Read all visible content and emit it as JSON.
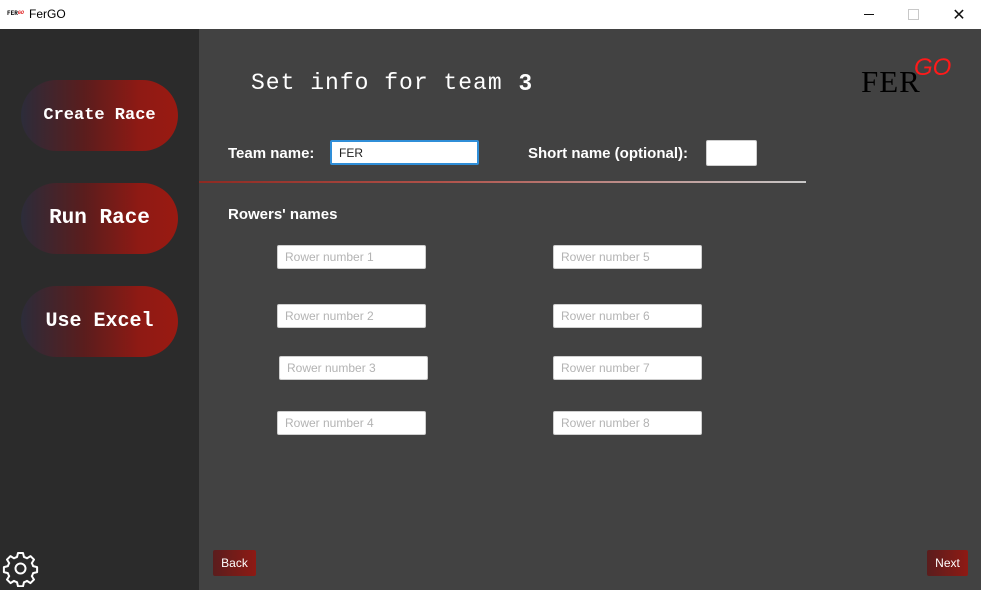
{
  "window": {
    "icon_text": "FER",
    "icon_text_go": "GO",
    "title": "FerGO",
    "minimize_label": "",
    "maximize_label": "",
    "close_label": "✕"
  },
  "sidebar": {
    "create_race": "Create Race",
    "run_race": "Run Race",
    "use_excel": "Use Excel",
    "settings_icon": "gear-icon"
  },
  "main": {
    "title": "Set info for team",
    "team_number": "3",
    "logo_fer": "FER",
    "logo_go": "GO",
    "team_name_label": "Team name:",
    "team_name_value": "FER",
    "short_name_label": "Short name (optional):",
    "short_name_value": "",
    "rowers_label": "Rowers' names",
    "rowers": [
      {
        "placeholder": "Rower number 1",
        "value": ""
      },
      {
        "placeholder": "Rower number 2",
        "value": ""
      },
      {
        "placeholder": "Rower number 3",
        "value": ""
      },
      {
        "placeholder": "Rower number 4",
        "value": ""
      },
      {
        "placeholder": "Rower number 5",
        "value": ""
      },
      {
        "placeholder": "Rower number 6",
        "value": ""
      },
      {
        "placeholder": "Rower number 7",
        "value": ""
      },
      {
        "placeholder": "Rower number 8",
        "value": ""
      }
    ],
    "back_label": "Back",
    "next_label": "Next"
  },
  "colors": {
    "accent_red": "#8e1a14",
    "logo_go": "#ff1a1a",
    "focus_blue": "#2f8ed8",
    "background": "#424242",
    "sidebar": "#2b2b2b"
  }
}
